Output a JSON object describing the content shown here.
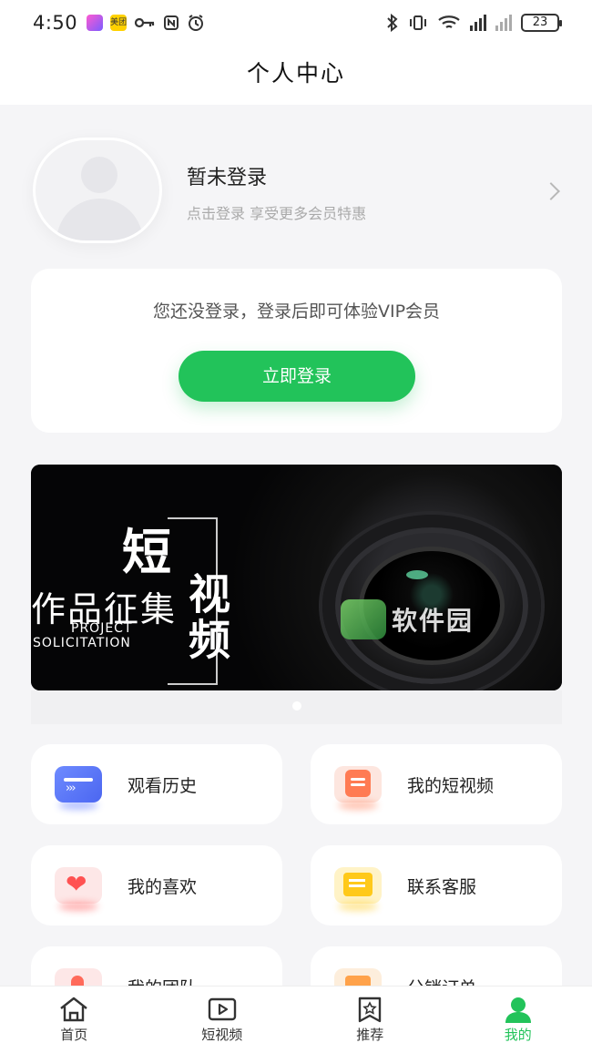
{
  "status_bar": {
    "time": "4:50",
    "app_badge": "美团",
    "battery": "23"
  },
  "header": {
    "title": "个人中心"
  },
  "profile": {
    "name": "暂未登录",
    "subtitle": "点击登录 享受更多会员特惠"
  },
  "login_card": {
    "hint": "您还没登录，登录后即可体验VIP会员",
    "button": "立即登录"
  },
  "banner": {
    "big_char_1": "短",
    "big_chars_2": "视频",
    "mid_text": "作品征集",
    "en_line_1": "PROJECT",
    "en_line_2": "SOLICITATION",
    "watermark": "软件园",
    "slide_count": 1
  },
  "menu": {
    "items": [
      {
        "label": "观看历史",
        "icon": "history-icon"
      },
      {
        "label": "我的短视频",
        "icon": "my-video-icon"
      },
      {
        "label": "我的喜欢",
        "icon": "heart-icon"
      },
      {
        "label": "联系客服",
        "icon": "customer-service-icon"
      },
      {
        "label": "我的团队",
        "icon": "team-icon"
      },
      {
        "label": "分销订单",
        "icon": "order-icon"
      }
    ]
  },
  "bottom_nav": {
    "items": [
      {
        "label": "首页",
        "icon": "home-icon"
      },
      {
        "label": "短视频",
        "icon": "video-play-icon"
      },
      {
        "label": "推荐",
        "icon": "recommend-star-icon"
      },
      {
        "label": "我的",
        "icon": "user-icon",
        "active": true
      }
    ]
  },
  "colors": {
    "accent": "#22c35a",
    "background": "#f5f5f7"
  }
}
